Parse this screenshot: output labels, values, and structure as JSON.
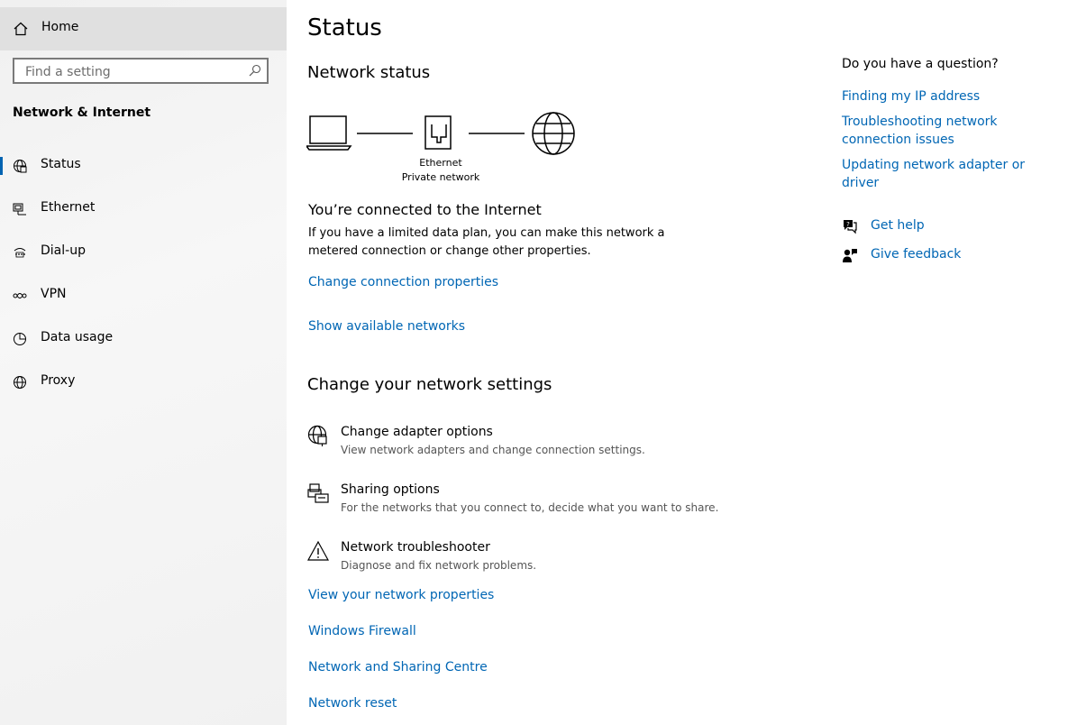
{
  "sidebar": {
    "home_label": "Home",
    "search_placeholder": "Find a setting",
    "section_title": "Network & Internet",
    "items": [
      {
        "label": "Status",
        "icon": "globe-status-icon"
      },
      {
        "label": "Ethernet",
        "icon": "ethernet-icon"
      },
      {
        "label": "Dial-up",
        "icon": "dial-up-icon"
      },
      {
        "label": "VPN",
        "icon": "vpn-icon"
      },
      {
        "label": "Data usage",
        "icon": "data-usage-icon"
      },
      {
        "label": "Proxy",
        "icon": "globe-icon"
      }
    ]
  },
  "main": {
    "title": "Status",
    "network_status_heading": "Network status",
    "diagram": {
      "adapter_label": "Ethernet",
      "network_label": "Private network"
    },
    "connected_title": "You’re connected to the Internet",
    "connected_desc": "If you have a limited data plan, you can make this network a metered connection or change other properties.",
    "change_connection_link": "Change connection properties",
    "show_networks_link": "Show available networks",
    "change_settings_heading": "Change your network settings",
    "settings": [
      {
        "title": "Change adapter options",
        "desc": "View network adapters and change connection settings."
      },
      {
        "title": "Sharing options",
        "desc": "For the networks that you connect to, decide what you want to share."
      },
      {
        "title": "Network troubleshooter",
        "desc": "Diagnose and fix network problems."
      }
    ],
    "links": [
      "View your network properties",
      "Windows Firewall",
      "Network and Sharing Centre",
      "Network reset"
    ]
  },
  "right": {
    "question": "Do you have a question?",
    "links": [
      "Finding my IP address",
      "Troubleshooting network connection issues",
      "Updating network adapter or driver"
    ],
    "get_help": "Get help",
    "give_feedback": "Give feedback"
  },
  "colors": {
    "accent": "#0066b4",
    "sidebar_bg": "#f2f2f2",
    "home_bg": "#e0e0e0"
  }
}
